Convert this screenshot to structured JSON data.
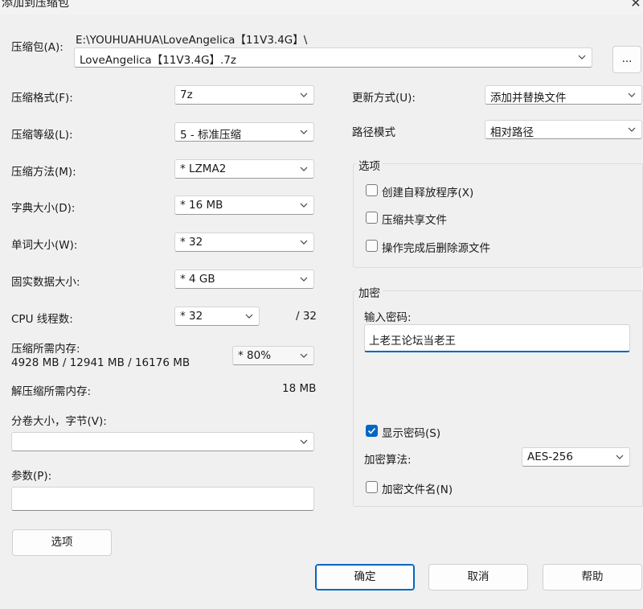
{
  "window": {
    "title": "添加到压缩包",
    "close_icon": "close-icon"
  },
  "archive": {
    "label": "压缩包(A):",
    "path": "E:\\YOUHUAHUA\\LoveAngelica【11V3.4G】\\",
    "filename": "LoveAngelica【11V3.4G】.7z",
    "browse_label": "..."
  },
  "left": {
    "format_label": "压缩格式(F):",
    "format_value": "7z",
    "level_label": "压缩等级(L):",
    "level_value": "5 - 标准压缩",
    "method_label": "压缩方法(M):",
    "method_value": "* LZMA2",
    "dict_label": "字典大小(D):",
    "dict_value": "* 16 MB",
    "word_label": "单词大小(W):",
    "word_value": "* 32",
    "solid_label": "固实数据大小:",
    "solid_value": "* 4 GB",
    "threads_label": "CPU 线程数:",
    "threads_value": "* 32",
    "threads_total": "/ 32",
    "mem_label": "压缩所需内存:",
    "mem_values": "4928 MB / 12941 MB / 16176 MB",
    "mem_percent": "* 80%",
    "decomp_mem_label": "解压缩所需内存:",
    "decomp_mem_value": "18 MB",
    "volume_label": "分卷大小，字节(V):",
    "volume_value": "",
    "params_label": "参数(P):",
    "params_value": "",
    "options_button": "选项"
  },
  "right": {
    "update_label": "更新方式(U):",
    "update_value": "添加并替换文件",
    "path_label": "路径模式",
    "path_value": "相对路径",
    "options_group": {
      "title": "选项",
      "items": [
        {
          "label": "创建自释放程序(X)",
          "checked": false
        },
        {
          "label": "压缩共享文件",
          "checked": false
        },
        {
          "label": "操作完成后删除源文件",
          "checked": false
        }
      ]
    },
    "encryption": {
      "title": "加密",
      "password_label": "输入密码:",
      "password_value": "上老王论坛当老王",
      "show_password_label": "显示密码(S)",
      "show_password_checked": true,
      "method_label": "加密算法:",
      "method_value": "AES-256",
      "encrypt_names_label": "加密文件名(N)",
      "encrypt_names_checked": false
    }
  },
  "buttons": {
    "ok": "确定",
    "cancel": "取消",
    "help": "帮助"
  },
  "colors": {
    "accent": "#0067c0",
    "background": "#f0f0f0"
  }
}
